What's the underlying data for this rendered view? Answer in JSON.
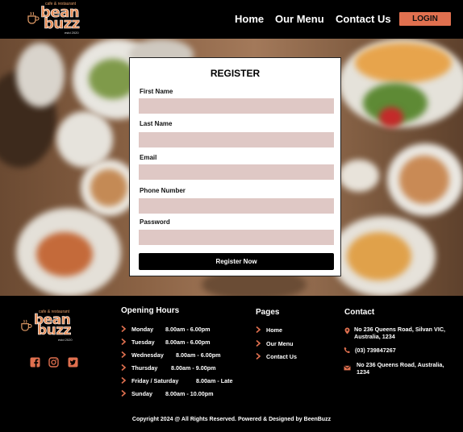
{
  "brand": {
    "tagline": "cafe & restaurant",
    "word1": "bean",
    "word2": "buzz",
    "est": "estd 2020"
  },
  "nav": {
    "home": "Home",
    "menu": "Our Menu",
    "contact": "Contact Us",
    "login": "LOGIN"
  },
  "register": {
    "title": "REGISTER",
    "fields": [
      {
        "label": "First Name",
        "value": ""
      },
      {
        "label": "Last Name",
        "value": ""
      },
      {
        "label": "Email",
        "value": ""
      },
      {
        "label": "Phone Number",
        "value": ""
      },
      {
        "label": "Password",
        "value": ""
      }
    ],
    "button": "Register Now"
  },
  "footer": {
    "hours_title": "Opening Hours",
    "hours": [
      {
        "day": "Monday",
        "time": "8.00am  -  6.00pm"
      },
      {
        "day": "Tuesday",
        "time": "8.00am  -  6.00pm"
      },
      {
        "day": "Wednesday",
        "time": "8.00am  -  6.00pm"
      },
      {
        "day": "Thursday",
        "time": "8.00am  -  9.00pm"
      },
      {
        "day": "Friday  /  Saturday",
        "time": "8.00am  -  Late"
      },
      {
        "day": "Sunday",
        "time": "8.00am  -  10.00pm"
      }
    ],
    "pages_title": "Pages",
    "pages": [
      "Home",
      "Our Menu",
      "Contact Us"
    ],
    "contact_title": "Contact",
    "address": "No 236 Queens Road, Silvan VIC, Australia, 1234",
    "phone": "(03) 739847267",
    "mail": "No 236 Queens Road,  Australia, 1234",
    "copyright": "Copyright 2024 @ All Rights Reserved. Powered & Designed by BeenBuzz"
  },
  "colors": {
    "accent": "#e0704f",
    "input_bg": "#dfc8c5"
  },
  "icons": [
    "coffee-cup-icon",
    "facebook-icon",
    "instagram-icon",
    "twitter-icon",
    "chevron-right-icon",
    "location-pin-icon",
    "phone-icon",
    "mail-icon"
  ]
}
